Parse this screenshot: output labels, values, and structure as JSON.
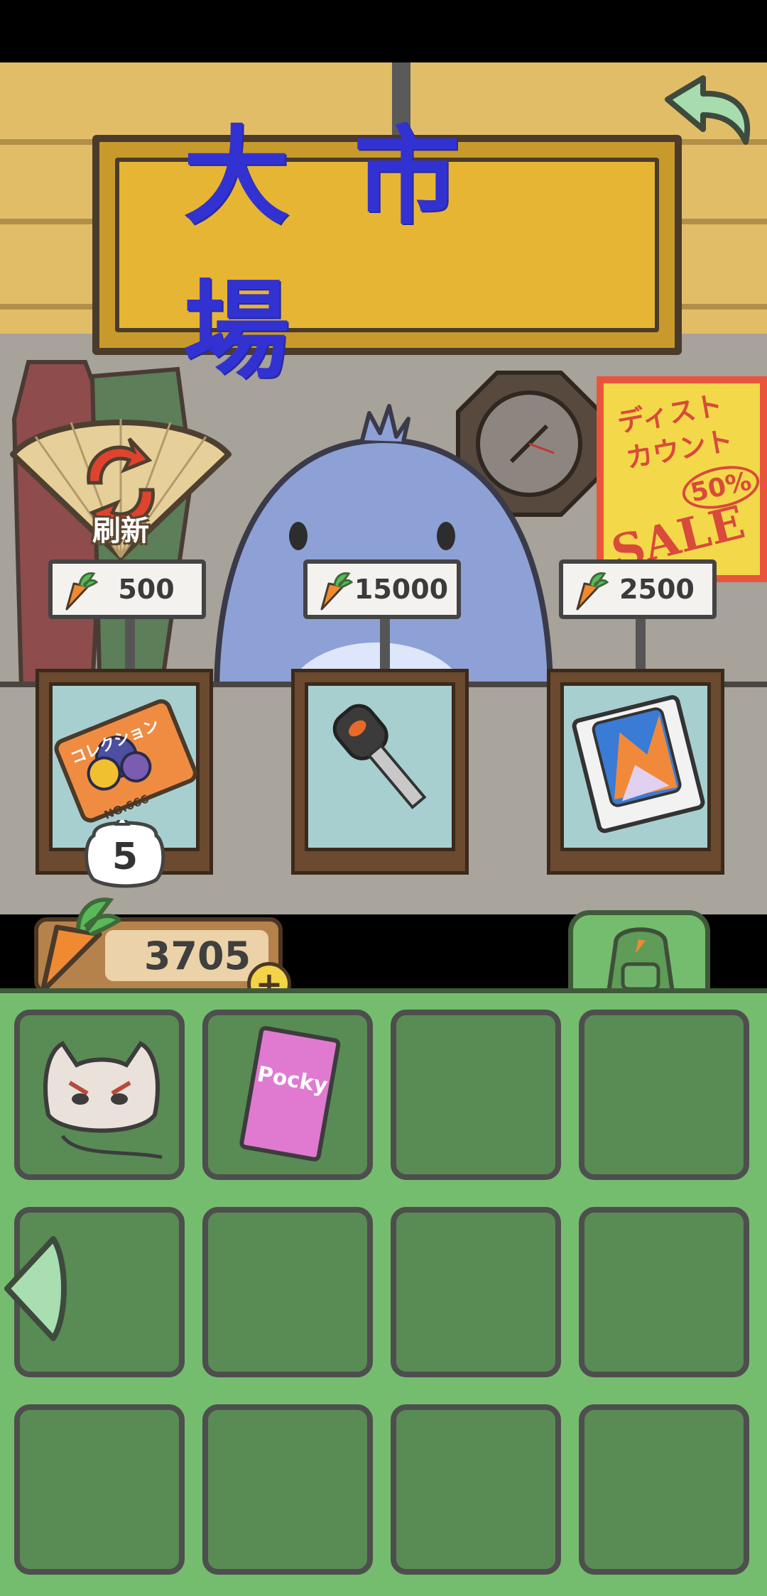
{
  "screen_title": "大市場",
  "refresh_label": "刷新",
  "shop_items": [
    {
      "name": "collection-ticket",
      "price": "500",
      "ticket_text": "コレクション",
      "ticket_number": "NO.666",
      "quantity": "5"
    },
    {
      "name": "car-key",
      "price": "15000"
    },
    {
      "name": "phone-box",
      "price": "2500"
    }
  ],
  "poster": {
    "line1": "ディスト",
    "line2": "カウント",
    "discount": "50%",
    "sale": "SALE"
  },
  "currency": {
    "amount": "3705",
    "add_label": "+"
  },
  "inventory": [
    {
      "slot": 1,
      "item": "cat-mask"
    },
    {
      "slot": 2,
      "item": "pocky-box",
      "label": "Pocky"
    },
    {
      "slot": 3,
      "item": ""
    },
    {
      "slot": 4,
      "item": ""
    },
    {
      "slot": 5,
      "item": ""
    },
    {
      "slot": 6,
      "item": ""
    },
    {
      "slot": 7,
      "item": ""
    },
    {
      "slot": 8,
      "item": ""
    },
    {
      "slot": 9,
      "item": ""
    },
    {
      "slot": 10,
      "item": ""
    },
    {
      "slot": 11,
      "item": ""
    },
    {
      "slot": 12,
      "item": ""
    }
  ],
  "colors": {
    "sign_text": "#3232d2",
    "inventory_bg": "#74bd6e",
    "slot_bg": "#598b54",
    "wall": "#e2bd68"
  },
  "icons": [
    "back-arrow-icon",
    "refresh-fan-icon",
    "carrot-icon",
    "plus-icon",
    "backpack-icon",
    "left-arrow-icon",
    "clock-icon"
  ]
}
